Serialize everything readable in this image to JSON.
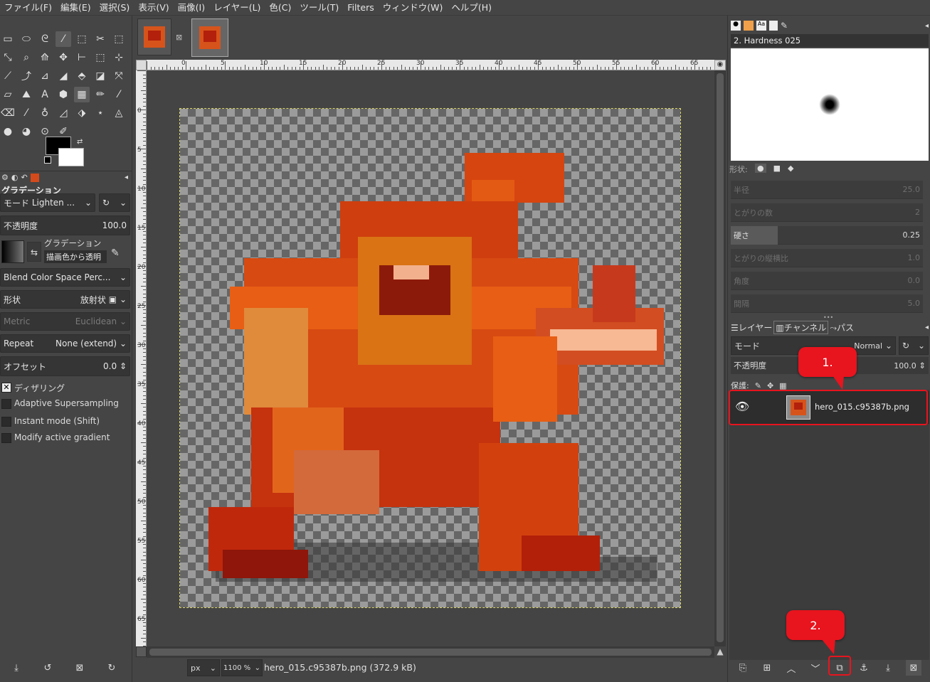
{
  "menubar": [
    "ファイル(F)",
    "編集(E)",
    "選択(S)",
    "表示(V)",
    "画像(I)",
    "レイヤー(L)",
    "色(C)",
    "ツール(T)",
    "Filters",
    "ウィンドウ(W)",
    "ヘルプ(H)"
  ],
  "tool_options": {
    "title": "グラデーション",
    "mode_label": "モード",
    "mode_value": "Lighten ...",
    "opacity_label": "不透明度",
    "opacity_value": "100.0",
    "gradient_label": "グラデーション",
    "gradient_value": "描画色から透明",
    "blend_color_space": "Blend Color Space Perc...",
    "shape_label": "形状",
    "shape_value": "放射状",
    "metric_label": "Metric",
    "metric_value": "Euclidean",
    "repeat_label": "Repeat",
    "repeat_value": "None (extend)",
    "offset_label": "オフセット",
    "offset_value": "0.0",
    "dithering": "ディザリング",
    "adaptive": "Adaptive Supersampling",
    "instant": "Instant mode  (Shift)",
    "modify": "Modify active gradient"
  },
  "ruler_labels": [
    "0",
    "5",
    "10",
    "15",
    "20",
    "25",
    "30",
    "35",
    "40",
    "45",
    "50",
    "55",
    "60",
    "65"
  ],
  "status": {
    "unit": "px",
    "zoom": "1100 %",
    "file": "hero_015.c95387b.png (372.9 kB)"
  },
  "brushes": {
    "brush_name": "2. Hardness 025",
    "shape_label": "形状:",
    "sliders": [
      {
        "label": "半径",
        "value": "25.0"
      },
      {
        "label": "とがりの数",
        "value": "2"
      },
      {
        "label": "硬さ",
        "value": "0.25"
      },
      {
        "label": "とがりの縦横比",
        "value": "1.0"
      },
      {
        "label": "角度",
        "value": "0.0"
      },
      {
        "label": "間隔",
        "value": "5.0"
      }
    ]
  },
  "layers": {
    "tabs": [
      "レイヤー",
      "チャンネル",
      "パス"
    ],
    "mode_label": "モード",
    "mode_value": "Normal",
    "opacity_label": "不透明度",
    "opacity_value": "100.0",
    "lock_label": "保護:",
    "layer_name": "hero_015.c95387b.png"
  },
  "callouts": [
    "1.",
    "2."
  ],
  "colors": {
    "callout": "#e8141e",
    "panel": "#454545"
  }
}
